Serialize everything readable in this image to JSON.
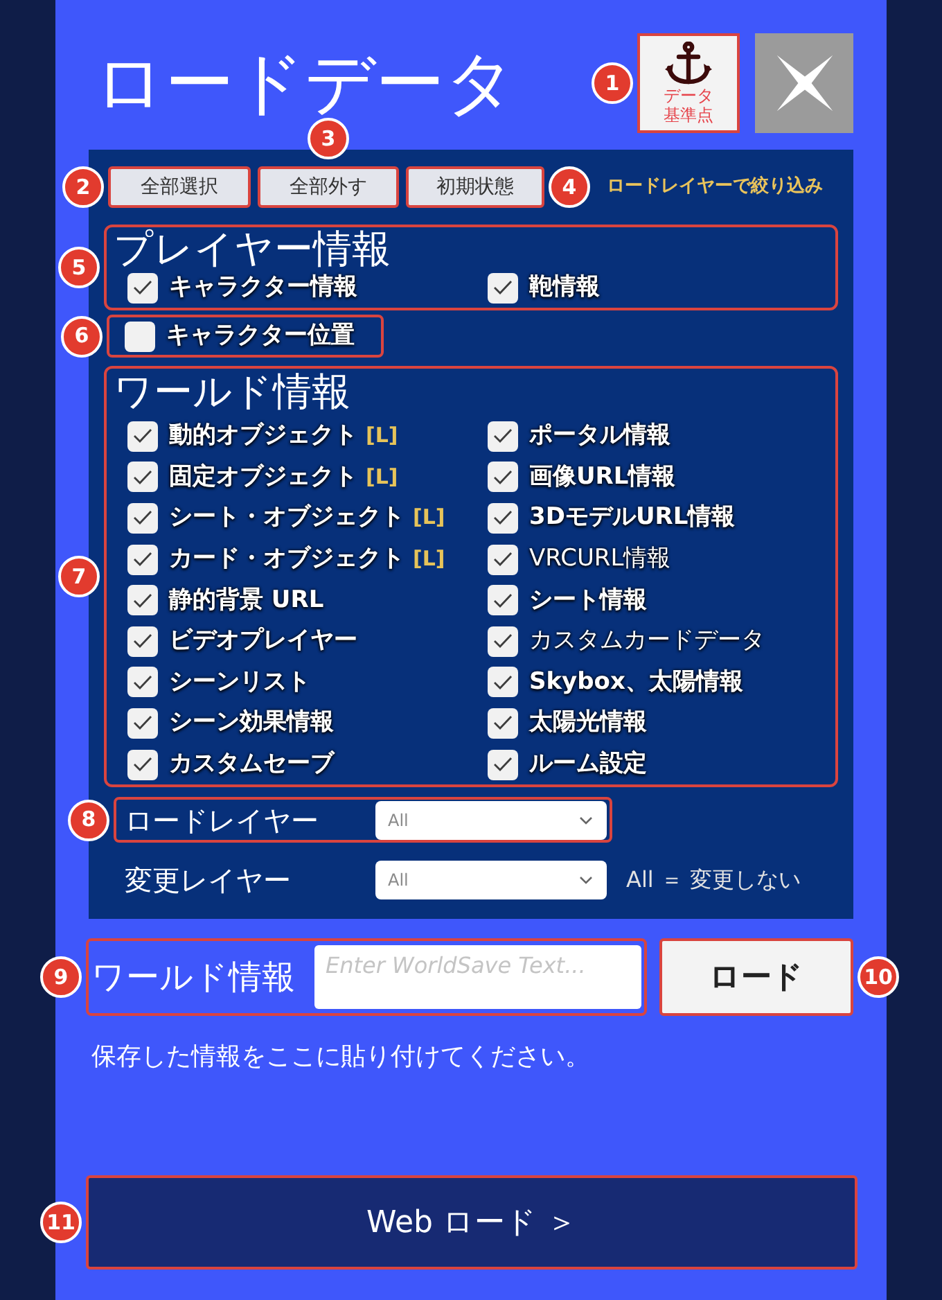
{
  "title": "ロードデータ",
  "anchor_button": {
    "label": "データ基準点",
    "callout": "1"
  },
  "actions": [
    {
      "label": "全部選択",
      "callout": "2"
    },
    {
      "label": "全部外す",
      "callout": "3"
    },
    {
      "label": "初期状態",
      "callout": "4"
    }
  ],
  "filter_note": "ロードレイヤーで絞り込み",
  "player_info": {
    "heading": "プレイヤー情報",
    "callout": "5",
    "items": [
      {
        "label": "キャラクター情報",
        "checked": true,
        "bold": true
      },
      {
        "label": "鞄情報",
        "checked": true,
        "bold": true
      }
    ]
  },
  "character_position": {
    "label": "キャラクター位置",
    "checked": false,
    "bold": true,
    "callout": "6"
  },
  "world_info": {
    "heading": "ワールド情報",
    "callout": "7",
    "items": [
      {
        "label": "動的オブジェクト",
        "tag": "[L]",
        "checked": true,
        "bold": true
      },
      {
        "label": "ポータル情報",
        "checked": true,
        "bold": true
      },
      {
        "label": "固定オブジェクト",
        "tag": "[L]",
        "checked": true,
        "bold": true
      },
      {
        "label": "画像URL情報",
        "checked": true,
        "bold": true
      },
      {
        "label": "シート・オブジェクト",
        "tag": "[L]",
        "checked": true,
        "bold": true
      },
      {
        "label": "3DモデルURL情報",
        "checked": true,
        "bold": true
      },
      {
        "label": "カード・オブジェクト",
        "tag": "[L]",
        "checked": true,
        "bold": true
      },
      {
        "label": "VRCURL情報",
        "checked": true,
        "bold": false
      },
      {
        "label": "静的背景 URL",
        "checked": true,
        "bold": true
      },
      {
        "label": "シート情報",
        "checked": true,
        "bold": true
      },
      {
        "label": "ビデオプレイヤー",
        "checked": true,
        "bold": true
      },
      {
        "label": "カスタムカードデータ",
        "checked": true,
        "bold": false
      },
      {
        "label": "シーンリスト",
        "checked": true,
        "bold": true
      },
      {
        "label": "Skybox、太陽情報",
        "checked": true,
        "bold": true
      },
      {
        "label": "シーン効果情報",
        "checked": true,
        "bold": true
      },
      {
        "label": "太陽光情報",
        "checked": true,
        "bold": true
      },
      {
        "label": "カスタムセーブ",
        "checked": true,
        "bold": true
      },
      {
        "label": "ルーム設定",
        "checked": true,
        "bold": true
      }
    ]
  },
  "layers": [
    {
      "label": "ロードレイヤー",
      "value": "All",
      "callout": "8"
    },
    {
      "label": "変更レイヤー",
      "value": "All",
      "note": "All ＝ 変更しない"
    }
  ],
  "world_text": {
    "label": "ワールド情報",
    "placeholder": "Enter WorldSave Text...",
    "callout": "9"
  },
  "load_button": {
    "label": "ロード",
    "callout": "10"
  },
  "instruction": "保存した情報をここに貼り付けてください。",
  "web_load_button": {
    "label": "Web ロード ＞",
    "callout": "11"
  }
}
